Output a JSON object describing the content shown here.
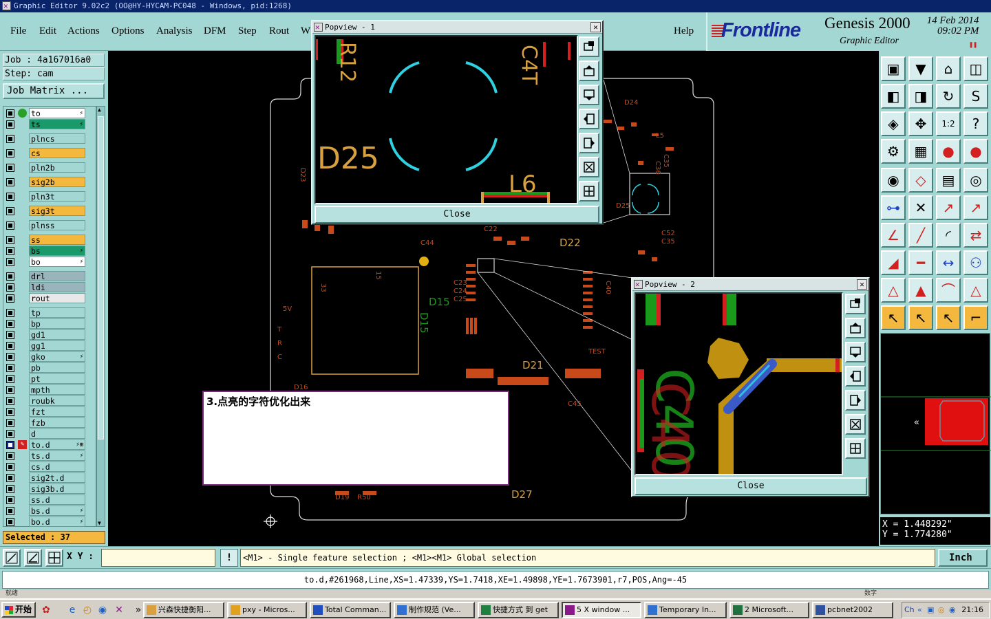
{
  "window": {
    "title": "Graphic Editor 9.02c2 (OO@HY-HYCAM-PC048 - Windows, pid:1268)"
  },
  "menu": [
    {
      "label": "File"
    },
    {
      "label": "Edit"
    },
    {
      "label": "Actions"
    },
    {
      "label": "Options"
    },
    {
      "label": "Analysis"
    },
    {
      "label": "DFM"
    },
    {
      "label": "Step"
    },
    {
      "label": "Rout"
    },
    {
      "label": "W"
    },
    {
      "label": "Help"
    }
  ],
  "brand": {
    "logo": "Frontline",
    "product": "Genesis 2000",
    "subtitle": "Graphic Editor",
    "date": "14 Feb 2014",
    "time": "09:02 PM"
  },
  "job": {
    "job_line": "Job : 4a167016a0",
    "step_line": "Step: cam",
    "matrix_button": "Job Matrix ..."
  },
  "layers": [
    {
      "name": "to",
      "color": "#ffffff",
      "dot": "#2aa02a",
      "mark": "⚡"
    },
    {
      "name": "ts",
      "color": "#1a9a6a",
      "mark": "⚡"
    },
    {
      "name": "plncs",
      "color": "#a3d7d4"
    },
    {
      "name": "cs",
      "color": "#f5b83f"
    },
    {
      "name": "pln2b",
      "color": "#a3d7d4"
    },
    {
      "name": "sig2b",
      "color": "#f5b83f"
    },
    {
      "name": "pln3t",
      "color": "#a3d7d4"
    },
    {
      "name": "sig3t",
      "color": "#f5b83f"
    },
    {
      "name": "plnss",
      "color": "#a3d7d4"
    },
    {
      "name": "ss",
      "color": "#f5b83f"
    },
    {
      "name": "bs",
      "color": "#1a9a6a",
      "mark": "⚡"
    },
    {
      "name": "bo",
      "color": "#ffffff",
      "mark": "⚡"
    },
    {
      "name": "drl",
      "color": "#9ab4bc"
    },
    {
      "name": "ldi",
      "color": "#9ab4bc"
    },
    {
      "name": "rout",
      "color": "#e8e8e8"
    },
    {
      "name": "tp",
      "color": "#a3d7d4"
    },
    {
      "name": "bp",
      "color": "#a3d7d4"
    },
    {
      "name": "gd1",
      "color": "#a3d7d4"
    },
    {
      "name": "gg1",
      "color": "#a3d7d4"
    },
    {
      "name": "gko",
      "color": "#a3d7d4",
      "mark": "⚡"
    },
    {
      "name": "pb",
      "color": "#a3d7d4"
    },
    {
      "name": "pt",
      "color": "#a3d7d4"
    },
    {
      "name": "mpth",
      "color": "#a3d7d4"
    },
    {
      "name": "roubk",
      "color": "#a3d7d4"
    },
    {
      "name": "fzt",
      "color": "#a3d7d4"
    },
    {
      "name": "fzb",
      "color": "#a3d7d4"
    },
    {
      "name": "d",
      "color": "#a3d7d4"
    },
    {
      "name": "to.d",
      "color": "#a3d7d4",
      "active": true,
      "mark": "⚡⊞"
    },
    {
      "name": "ts.d",
      "color": "#a3d7d4",
      "mark": "⚡"
    },
    {
      "name": "cs.d",
      "color": "#a3d7d4"
    },
    {
      "name": "sig2t.d",
      "color": "#a3d7d4"
    },
    {
      "name": "sig3b.d",
      "color": "#a3d7d4"
    },
    {
      "name": "ss.d",
      "color": "#a3d7d4"
    },
    {
      "name": "bs.d",
      "color": "#a3d7d4",
      "mark": "⚡"
    },
    {
      "name": "bo.d",
      "color": "#a3d7d4",
      "mark": "⚡"
    }
  ],
  "selected": "Selected : 37",
  "canvas": {
    "labels": [
      "D24",
      "D23",
      "L5",
      "C35",
      "C36",
      "D25",
      "C52",
      "C35",
      "D22",
      "C22",
      "C23",
      "C24",
      "C25",
      "C44",
      "C40",
      "D15",
      "D15",
      "5V",
      "T",
      "R",
      "C",
      "TEST",
      "D21",
      "C45",
      "D16",
      "D27",
      "D19",
      "R50",
      "33",
      "15"
    ],
    "note": "3.点亮的字符优化出来"
  },
  "popview1": {
    "title": "Popview - 1",
    "labels": [
      "R12",
      "C4T",
      "D25",
      "L6"
    ],
    "close": "Close"
  },
  "popview2": {
    "title": "Popview - 2",
    "labels": [
      "C40"
    ],
    "close": "Close"
  },
  "coords": {
    "x": "X = 1.448292\"",
    "y": "Y = 1.774280\""
  },
  "command": {
    "xy_label": "X Y :",
    "xy_value": "",
    "info": "!",
    "prompt": "<M1> - Single feature selection ; <M1><M1> Global selection",
    "unit": "Inch"
  },
  "feature_line": "to.d,#261968,Line,XS=1.47339,YS=1.7418,XE=1.49898,YE=1.7673901,r7,POS,Ang=-45",
  "status_strip": {
    "left": "就绪",
    "right": "数字"
  },
  "taskbar": {
    "start": "开始",
    "tasks": [
      {
        "label": "兴森快捷衡阳...",
        "color": "#d9a040"
      },
      {
        "label": "pxy - Micros...",
        "color": "#e0a020"
      },
      {
        "label": "Total Comman...",
        "color": "#2050c0"
      },
      {
        "label": "制作规范 (Ve...",
        "color": "#3070d0"
      },
      {
        "label": "快捷方式 到 get",
        "color": "#208040"
      },
      {
        "label": "5 X window ...",
        "color": "#8a1a8a",
        "pressed": true
      },
      {
        "label": "Temporary In...",
        "color": "#3070d0"
      },
      {
        "label": "2 Microsoft...",
        "color": "#207040"
      },
      {
        "label": "pcbnet2002",
        "color": "#3050a0"
      }
    ],
    "clock": "21:16"
  }
}
